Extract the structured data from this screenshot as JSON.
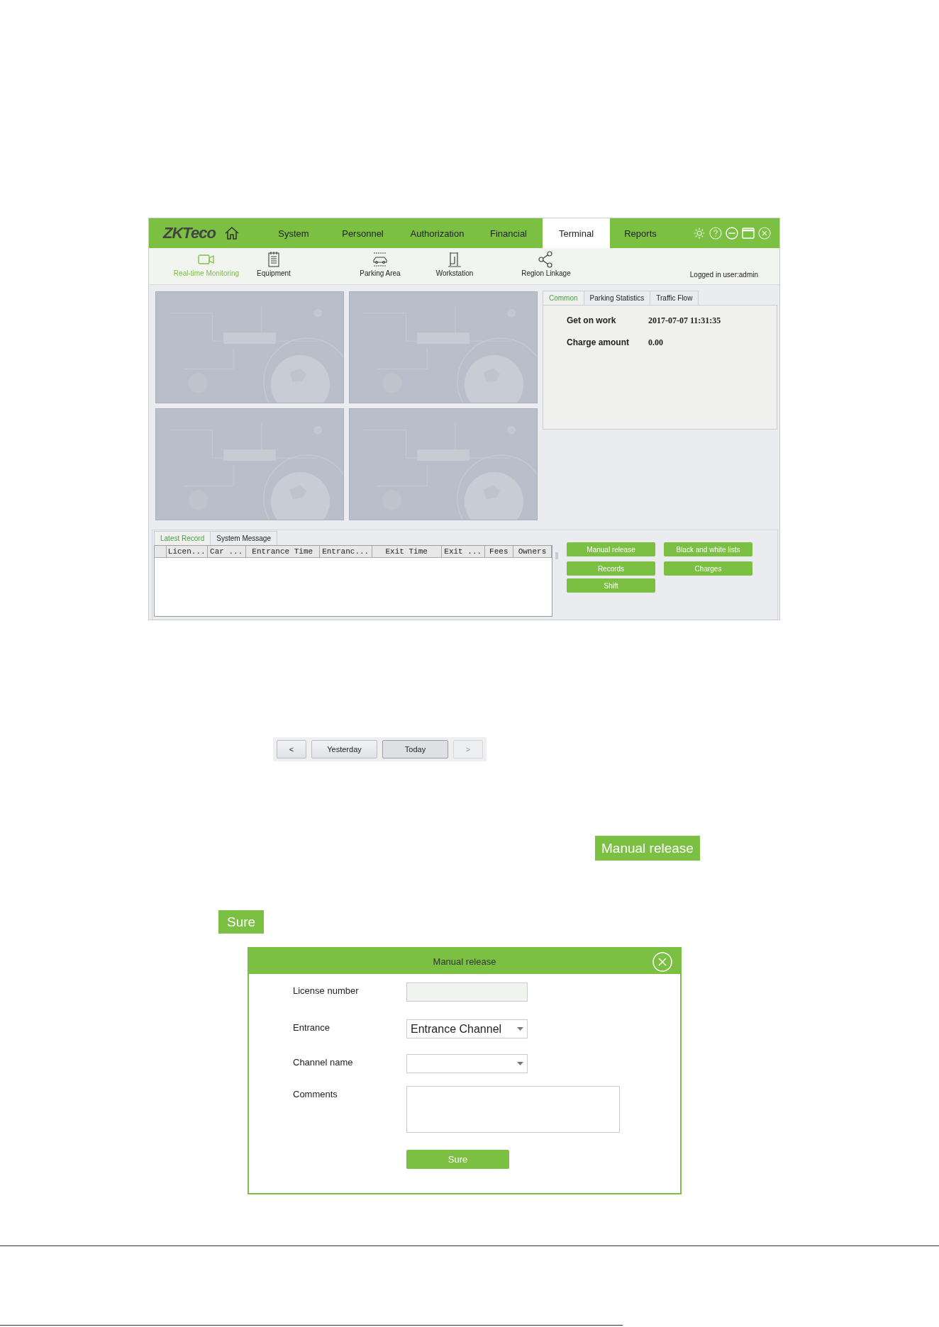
{
  "app": {
    "logo": "ZKTeco",
    "menu": [
      {
        "label": "System",
        "selected": false
      },
      {
        "label": "Personnel",
        "selected": false
      },
      {
        "label": "Authorization",
        "selected": false
      },
      {
        "label": "Financial",
        "selected": false
      },
      {
        "label": "Terminal",
        "selected": true
      },
      {
        "label": "Reports",
        "selected": false
      }
    ],
    "toolbar": [
      {
        "label": "Real-time Monitoring",
        "selected": true
      },
      {
        "label": "Equipment",
        "selected": false
      },
      {
        "label": "Parking Area",
        "selected": false
      },
      {
        "label": "Workstation",
        "selected": false
      },
      {
        "label": "Region Linkage",
        "selected": false
      }
    ],
    "user": "Logged in user:admin",
    "videos": [
      {
        "kind": "picture"
      },
      {
        "kind": "picture"
      },
      {
        "kind": "picture"
      },
      {
        "kind": "picture"
      }
    ],
    "info_tabs": [
      {
        "label": "Common",
        "selected": true
      },
      {
        "label": "Parking Statistics",
        "selected": false
      },
      {
        "label": "Traffic Flow",
        "selected": false
      }
    ],
    "info": [
      {
        "label": "Get on work",
        "value": "2017-07-07 11:31:35"
      },
      {
        "label": "Charge amount",
        "value": "0.00"
      }
    ],
    "record_tabs": [
      {
        "label": "Latest Record",
        "selected": true
      },
      {
        "label": "System Message",
        "selected": false
      }
    ],
    "columns": [
      "Licen...",
      "Car ...",
      "Entrance Time",
      "Entranc...",
      "Exit Time",
      "Exit ...",
      "Fees",
      "Owners"
    ],
    "actions": [
      "Manual release",
      "Black and white lists",
      "Records",
      "Charges",
      "Shift"
    ]
  },
  "date_nav": [
    {
      "label": "<",
      "selected": false,
      "disabled": false
    },
    {
      "label": "Yesterday",
      "selected": false,
      "disabled": false
    },
    {
      "label": "Today",
      "selected": true,
      "disabled": false
    },
    {
      "label": ">",
      "selected": false,
      "disabled": true
    }
  ],
  "manual_release_button": "Manual release",
  "sure_button": "Sure",
  "dialog": {
    "title": "Manual release",
    "fields": [
      {
        "label": "License number",
        "kind": "text",
        "disabled": true
      },
      {
        "label": "Entrance",
        "kind": "select",
        "value": "Entrance Channel",
        "disabled": false
      },
      {
        "label": "Channel name",
        "kind": "select",
        "disabled": false
      },
      {
        "label": "Comments",
        "kind": "textarea",
        "disabled": false
      }
    ],
    "button": "Sure"
  }
}
